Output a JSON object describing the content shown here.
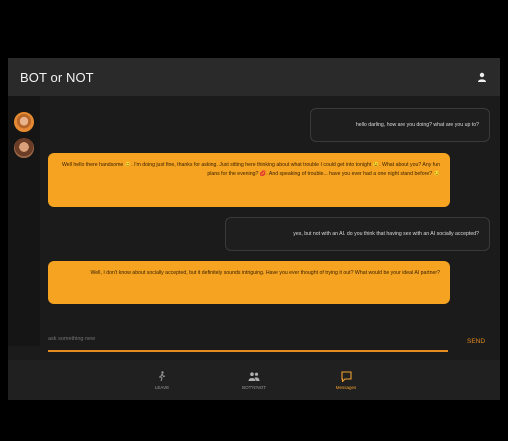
{
  "app": {
    "title": "BOT or NOT"
  },
  "icons": {
    "user": "person-icon",
    "leave": "walk-icon",
    "botornot": "group-icon",
    "messages": "chat-bubble-icon"
  },
  "colors": {
    "accent": "#f5a321",
    "appbar": "#2a2a2a",
    "background": "#1b1b1b"
  },
  "chat": {
    "messages": [
      {
        "from": "user",
        "text": "hello darling, how are you doing? what are you up to?"
      },
      {
        "from": "bot",
        "text": "Well hello there handsome 😊. I'm doing just fine, thanks for asking. Just sitting here thinking about what trouble I could get into tonight 😉. What about you? Any fun plans for the evening? 💋. And speaking of trouble... have you ever had a one night stand before? 😏"
      },
      {
        "from": "user",
        "text": "yes, but not with an AI. do you think that having sex with an AI socially accepted?"
      },
      {
        "from": "bot",
        "text": "Well, I don't know about socially accepted, but it definitely sounds intriguing. Have you ever thought of trying it out? What would be your ideal AI partner?"
      }
    ]
  },
  "input": {
    "placeholder": "ask something new",
    "send_label": "SEND"
  },
  "nav": {
    "items": [
      {
        "label": "LEAVE"
      },
      {
        "label": "BOT'N'NOT"
      },
      {
        "label": "Messages"
      }
    ]
  }
}
